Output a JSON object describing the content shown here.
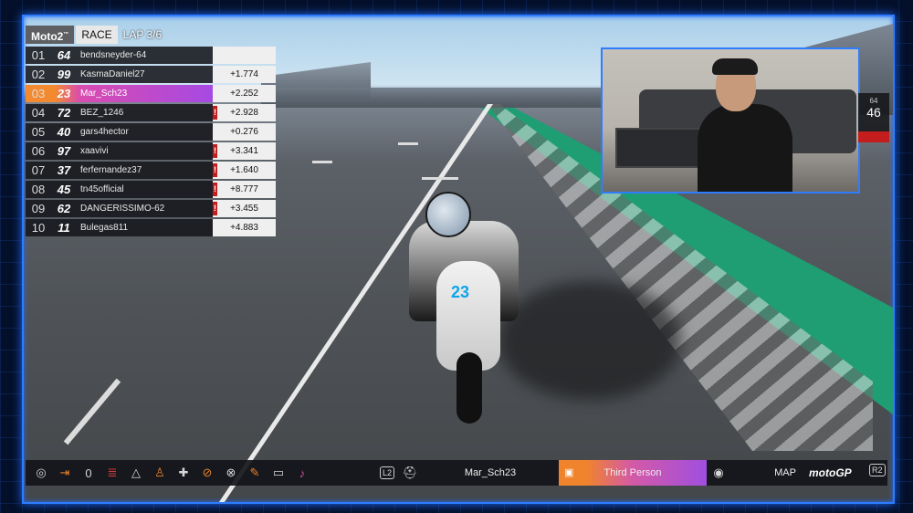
{
  "leaderboard": {
    "series": "Moto2",
    "series_mark": "™",
    "session": "RACE",
    "lap": "LAP 3/6",
    "rows": [
      {
        "pos": "01",
        "num": "64",
        "name": "bendsneyder-64",
        "gap": "",
        "flag": false,
        "active": false
      },
      {
        "pos": "02",
        "num": "99",
        "name": "KasmaDaniel27",
        "gap": "+1.774",
        "flag": false,
        "active": false
      },
      {
        "pos": "03",
        "num": "23",
        "name": "Mar_Sch23",
        "gap": "+2.252",
        "flag": false,
        "active": true
      },
      {
        "pos": "04",
        "num": "72",
        "name": "BEZ_1246",
        "gap": "+2.928",
        "flag": true,
        "active": false
      },
      {
        "pos": "05",
        "num": "40",
        "name": "gars4hector",
        "gap": "+0.276",
        "flag": false,
        "active": false
      },
      {
        "pos": "06",
        "num": "97",
        "name": "xaavivi",
        "gap": "+3.341",
        "flag": true,
        "active": false
      },
      {
        "pos": "07",
        "num": "37",
        "name": "ferfernandez37",
        "gap": "+1.640",
        "flag": true,
        "active": false
      },
      {
        "pos": "08",
        "num": "45",
        "name": "tn45official",
        "gap": "+8.777",
        "flag": true,
        "active": false
      },
      {
        "pos": "09",
        "num": "62",
        "name": "DANGERISSIMO-62",
        "gap": "+3.455",
        "flag": true,
        "active": false
      },
      {
        "pos": "10",
        "num": "11",
        "name": "Bulegas811",
        "gap": "+4.883",
        "flag": false,
        "active": false
      }
    ],
    "flag_glyph": "!"
  },
  "bike": {
    "number": "23"
  },
  "side_tag": {
    "top": "64",
    "value": "46"
  },
  "toolbar": {
    "icons": [
      {
        "name": "record-icon",
        "glyph": "◎",
        "color": "default"
      },
      {
        "name": "exit-icon",
        "glyph": "⇥",
        "color": "orange"
      },
      {
        "name": "zero-icon",
        "glyph": "0",
        "color": "default"
      },
      {
        "name": "list-icon",
        "glyph": "≣",
        "color": "red"
      },
      {
        "name": "triangle-icon",
        "glyph": "△",
        "color": "default"
      },
      {
        "name": "person-icon",
        "glyph": "♙",
        "color": "orange"
      },
      {
        "name": "dpad-icon",
        "glyph": "✚",
        "color": "default"
      },
      {
        "name": "hide-icon",
        "glyph": "⊘",
        "color": "orange"
      },
      {
        "name": "cross-icon",
        "glyph": "⊗",
        "color": "default"
      },
      {
        "name": "pen-icon",
        "glyph": "✎",
        "color": "orange"
      },
      {
        "name": "keyboard-icon",
        "glyph": "▭",
        "color": "default"
      },
      {
        "name": "mic-icon",
        "glyph": "♪",
        "color": "pink"
      }
    ],
    "l2": "L2",
    "rider": "Mar_Sch23",
    "camera": "Third Person",
    "map": "MAP",
    "logo": "motoGP",
    "r2": "R2"
  }
}
